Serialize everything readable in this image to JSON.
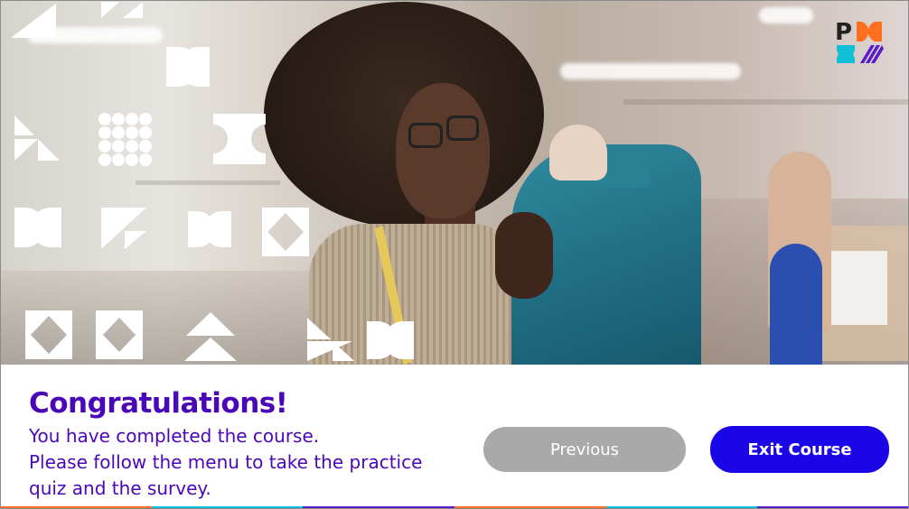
{
  "heading": "Congratulations!",
  "message_lines": [
    "You have completed the course.",
    "Please follow the menu to take the practice",
    "quiz and the survey."
  ],
  "buttons": {
    "previous_label": "Previous",
    "exit_label": "Exit Course"
  },
  "logo": {
    "icon": "pmi-logo-icon",
    "letter": "P"
  },
  "colors": {
    "heading": "#4a07b8",
    "exit_button": "#1b06e8",
    "previous_button": "#a9a9a9",
    "logo_orange": "#ff6f1f",
    "logo_cyan": "#10c0d8",
    "logo_purple": "#5a1cc8",
    "strip": [
      "#ff6f1f",
      "#10c0d8",
      "#5a1cc8",
      "#ff6f1f",
      "#10c0d8",
      "#5a1cc8"
    ]
  }
}
